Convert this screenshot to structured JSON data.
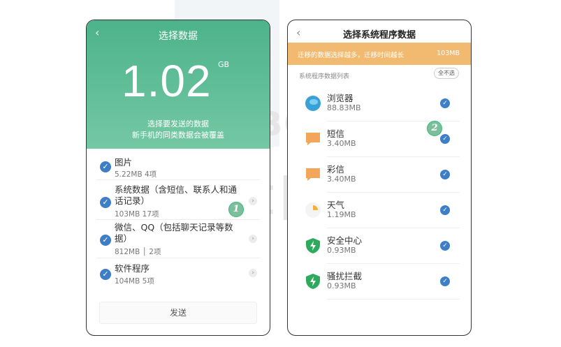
{
  "watermark": {
    "english": "HZ BOOKS",
    "chinese": "华章图书"
  },
  "screen1": {
    "back_icon": "‹",
    "title": "选择数据",
    "size_value": "1.02",
    "size_unit": "GB",
    "hint_line1": "选择要发送的数据",
    "hint_line2": "新手机的同类数据会被覆盖",
    "items": [
      {
        "title_line1": "图片",
        "title_line2": "",
        "sub": "5.22MB   4项"
      },
      {
        "title_line1": "系统数据（含短信、联系人和通",
        "title_line2": "话记录）",
        "sub": "103MB   17项"
      },
      {
        "title_line1": "微信、QQ（包括聊天记录等数",
        "title_line2": "据）",
        "sub": "812MB │ 2项"
      },
      {
        "title_line1": "软件程序",
        "title_line2": "",
        "sub": "104MB   5项"
      }
    ],
    "send_label": "发送",
    "callout": "1"
  },
  "screen2": {
    "back_icon": "‹",
    "title": "选择系统程序数据",
    "warning": "迁移的数据选择越多，迁移时间越长",
    "warning_size": "103MB",
    "list_header": "系统程序数据列表",
    "deselect_all": "全不选",
    "apps": [
      {
        "name": "浏览器",
        "size": "88.83MB",
        "icon": "browser-icon"
      },
      {
        "name": "短信",
        "size": "3.40MB",
        "icon": "sms-icon"
      },
      {
        "name": "彩信",
        "size": "3.40MB",
        "icon": "mms-icon"
      },
      {
        "name": "天气",
        "size": "1.19MB",
        "icon": "weather-icon"
      },
      {
        "name": "安全中心",
        "size": "0.93MB",
        "icon": "security-center-icon"
      },
      {
        "name": "骚扰拦截",
        "size": "0.93MB",
        "icon": "harassment-block-icon"
      }
    ],
    "callout": "2"
  },
  "colors": {
    "green": "#4cb38a",
    "orange": "#f2ba71",
    "check_blue": "#3d7ec7"
  }
}
